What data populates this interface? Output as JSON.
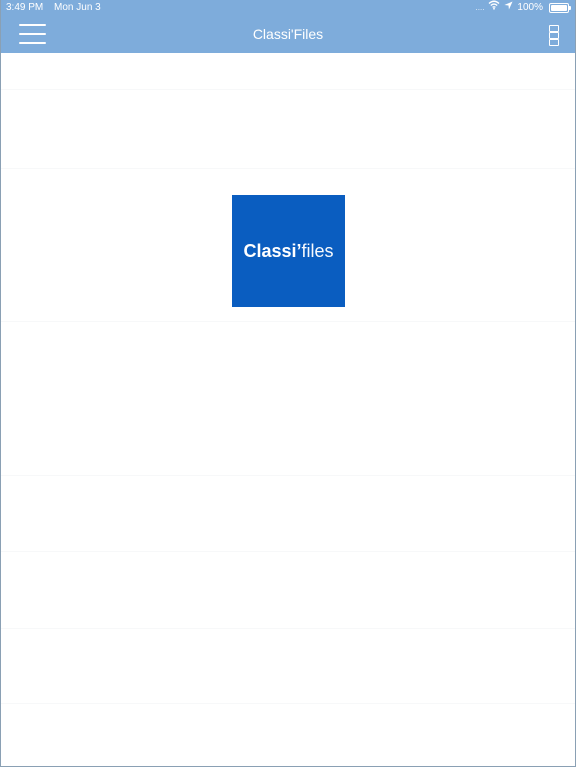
{
  "status_bar": {
    "time": "3:49 PM",
    "date": "Mon Jun 3",
    "signal": "....",
    "battery_percent": "100%",
    "icons": [
      "wifi-icon",
      "location-arrow-icon",
      "battery-icon"
    ]
  },
  "header": {
    "title": "Classi'Files",
    "menu_icon": "hamburger-menu-icon",
    "more_icon": "more-options-icon"
  },
  "logo": {
    "text_bold": "Classi’",
    "text_light": "files",
    "background_color": "#0a5dc0"
  },
  "colors": {
    "header_background": "#7eacdb",
    "page_background": "#ffffff"
  }
}
